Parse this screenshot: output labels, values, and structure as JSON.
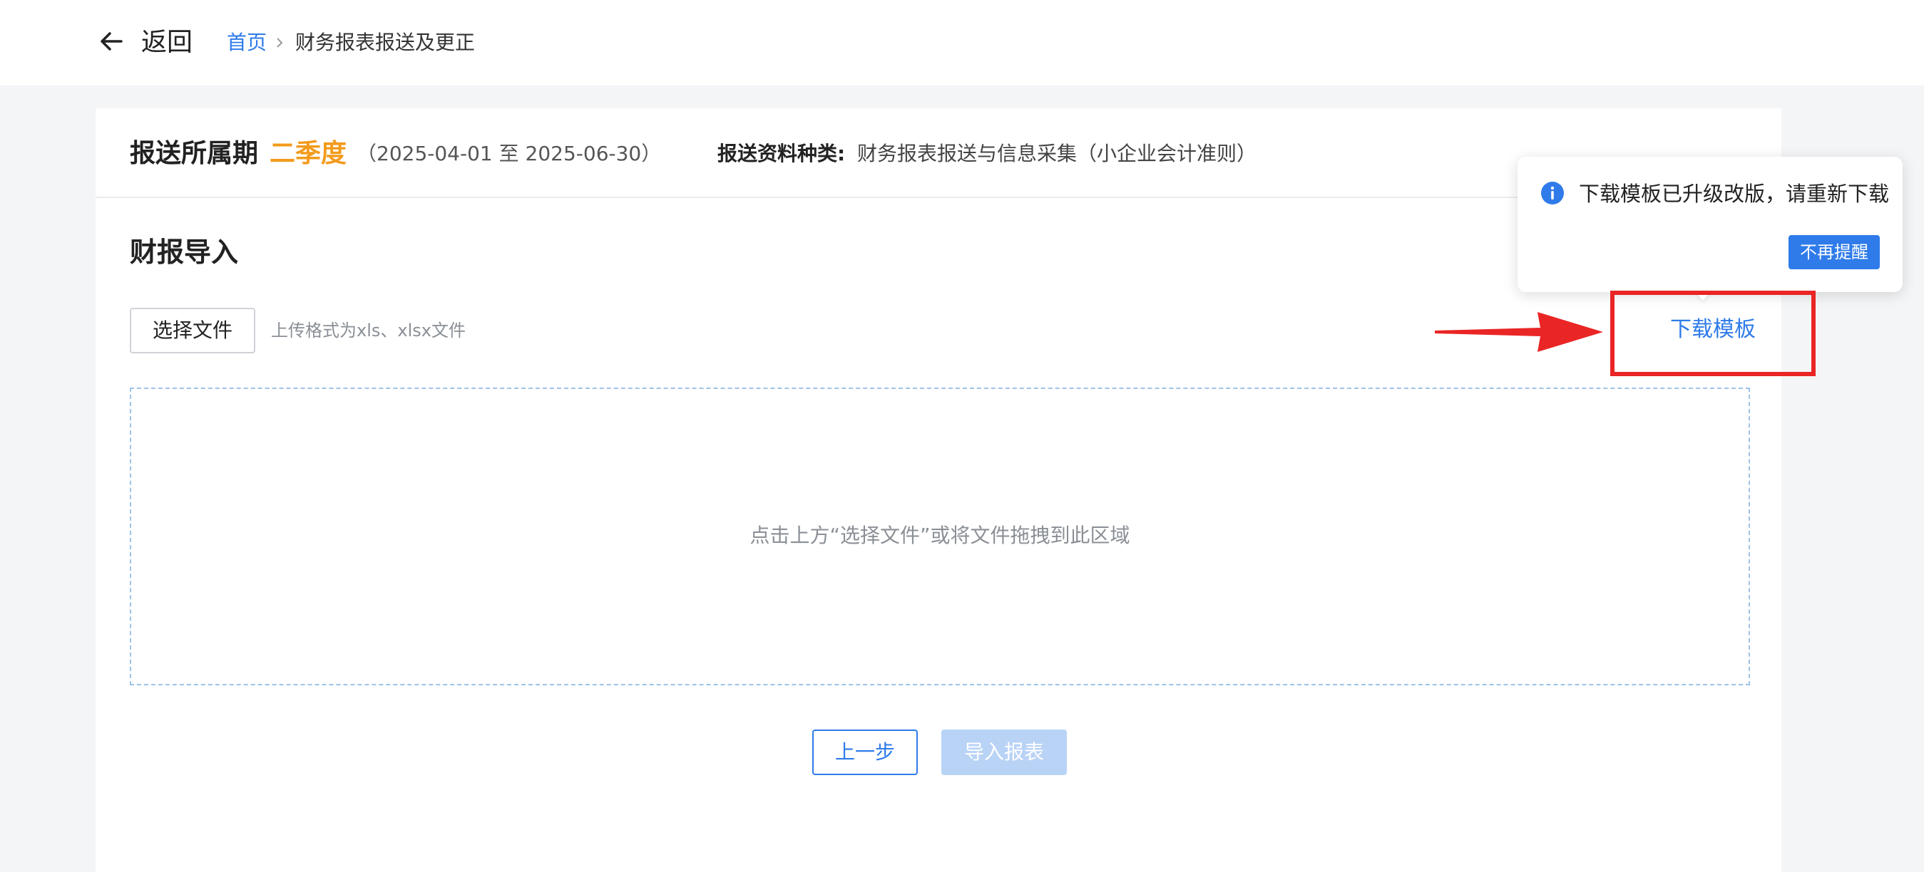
{
  "header": {
    "back_label": "返回",
    "breadcrumb": {
      "home": "首页",
      "current": "财务报表报送及更正"
    }
  },
  "period": {
    "label": "报送所属期",
    "quarter": "二季度",
    "range": "（2025-04-01 至 2025-06-30）",
    "type_label": "报送资料种类:",
    "type_value": "财务报表报送与信息采集（小企业会计准则）"
  },
  "import_section": {
    "title": "财报导入",
    "choose_file_label": "选择文件",
    "upload_hint": "上传格式为xls、xlsx文件",
    "download_template_label": "下载模板",
    "drop_zone_text": "点击上方“选择文件”或将文件拖拽到此区域"
  },
  "actions": {
    "prev_label": "上一步",
    "import_label": "导入报表"
  },
  "popover": {
    "message": "下载模板已升级改版，请重新下载",
    "dismiss_label": "不再提醒"
  },
  "colors": {
    "accent": "#2f7bea",
    "quarter": "#f39a1b",
    "annotation": "#ea2525",
    "disabled_button": "#b9d3f6"
  },
  "icons": {
    "back": "arrow-left-icon",
    "breadcrumb_separator": "chevron-right-icon",
    "info": "info-icon"
  }
}
